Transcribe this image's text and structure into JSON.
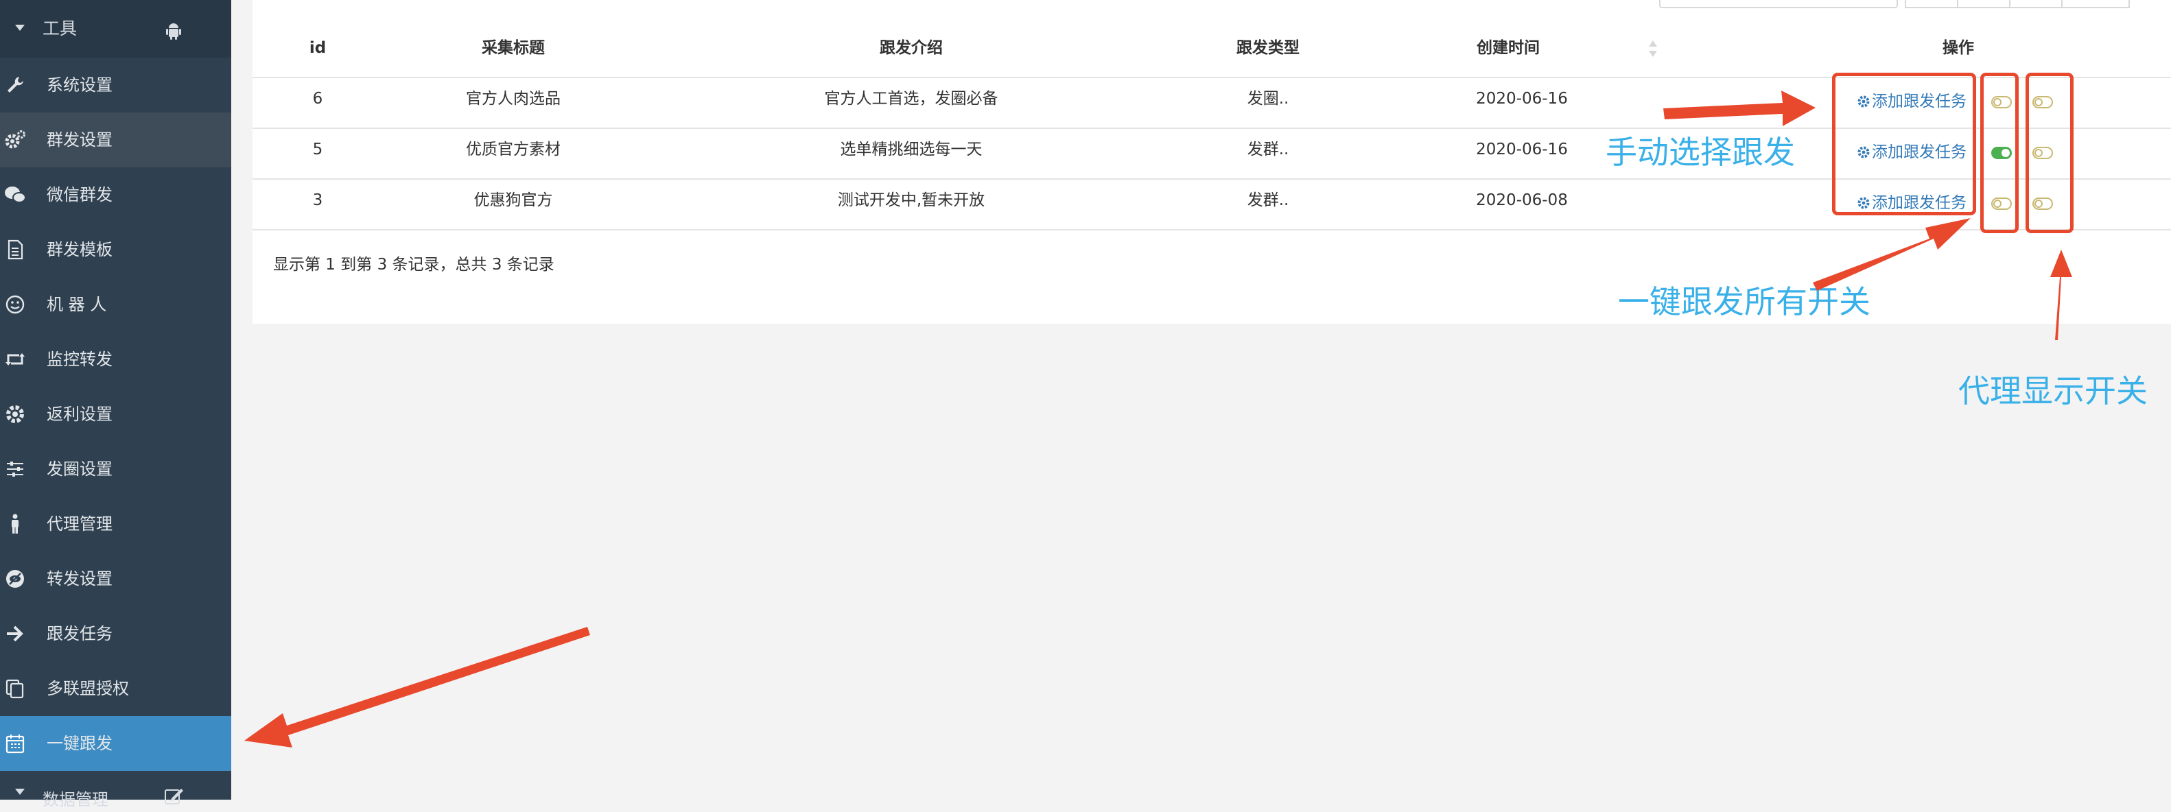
{
  "sidebar": {
    "group_label": "工具",
    "items": [
      {
        "label": "系统设置",
        "icon": "wrench-icon"
      },
      {
        "label": "群发设置",
        "icon": "gears-icon"
      },
      {
        "label": "微信群发",
        "icon": "wechat-icon"
      },
      {
        "label": "群发模板",
        "icon": "document-icon"
      },
      {
        "label": "机 器 人",
        "icon": "smiley-icon"
      },
      {
        "label": "监控转发",
        "icon": "retweet-icon"
      },
      {
        "label": "返利设置",
        "icon": "gear-icon"
      },
      {
        "label": "发圈设置",
        "icon": "sliders-icon"
      },
      {
        "label": "代理管理",
        "icon": "person-icon"
      },
      {
        "label": "转发设置",
        "icon": "eye-slash-icon"
      },
      {
        "label": "跟发任务",
        "icon": "arrow-right-icon"
      },
      {
        "label": "多联盟授权",
        "icon": "copy-icon"
      },
      {
        "label": "一键跟发",
        "icon": "calendar-icon"
      }
    ],
    "bottom_label": "数据管理"
  },
  "table": {
    "headers": {
      "id": "id",
      "title": "采集标题",
      "intro": "跟发介绍",
      "type": "跟发类型",
      "created": "创建时间",
      "ops": "操作"
    },
    "rows": [
      {
        "id": "6",
        "title": "官方人肉选品",
        "intro": "官方人工首选，发圈必备",
        "type": "发圈..",
        "created": "2020-06-16",
        "action": "添加跟发任务",
        "switch1_on": false,
        "switch2_on": false
      },
      {
        "id": "5",
        "title": "优质官方素材",
        "intro": "选单精挑细选每一天",
        "type": "发群..",
        "created": "2020-06-16",
        "action": "添加跟发任务",
        "switch1_on": true,
        "switch2_on": false
      },
      {
        "id": "3",
        "title": "优惠狗官方",
        "intro": "测试开发中,暂未开放",
        "type": "发群..",
        "created": "2020-06-08",
        "action": "添加跟发任务",
        "switch1_on": false,
        "switch2_on": false
      }
    ],
    "footer": "显示第 1 到第 3 条记录，总共 3 条记录"
  },
  "annotations": {
    "manual": "手动选择跟发",
    "all_switch": "一键跟发所有开关",
    "agent_switch": "代理显示开关"
  },
  "colors": {
    "sidebar_bg": "#2f4050",
    "sidebar_active": "#3d8dc4",
    "link": "#337ab7",
    "annotation_red": "#e8482c",
    "annotation_text": "#3ab0e8",
    "switch_on": "#4cb050"
  }
}
